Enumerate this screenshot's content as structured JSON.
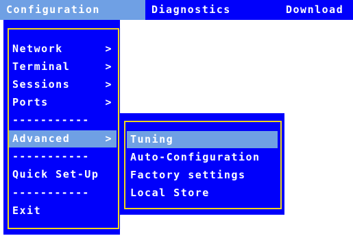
{
  "menubar": {
    "items": [
      {
        "label": "Configuration"
      },
      {
        "label": "Diagnostics"
      },
      {
        "label": "Download"
      }
    ]
  },
  "config_menu": {
    "items": [
      {
        "label": "Network",
        "arrow": ">"
      },
      {
        "label": "Terminal",
        "arrow": ">"
      },
      {
        "label": "Sessions",
        "arrow": ">"
      },
      {
        "label": "Ports",
        "arrow": ">"
      },
      {
        "label": "Advanced",
        "arrow": ">"
      },
      {
        "label": "Quick Set-Up"
      },
      {
        "label": "Exit"
      }
    ],
    "separator": "-----------"
  },
  "advanced_submenu": {
    "items": [
      {
        "label": "Tuning"
      },
      {
        "label": "Auto-Configuration"
      },
      {
        "label": "Factory settings"
      },
      {
        "label": "Local Store"
      }
    ]
  },
  "colors": {
    "menu_bg": "#0000fb",
    "highlight": "#6fa0e4",
    "border": "#f0d61d",
    "text": "#ffffff"
  }
}
